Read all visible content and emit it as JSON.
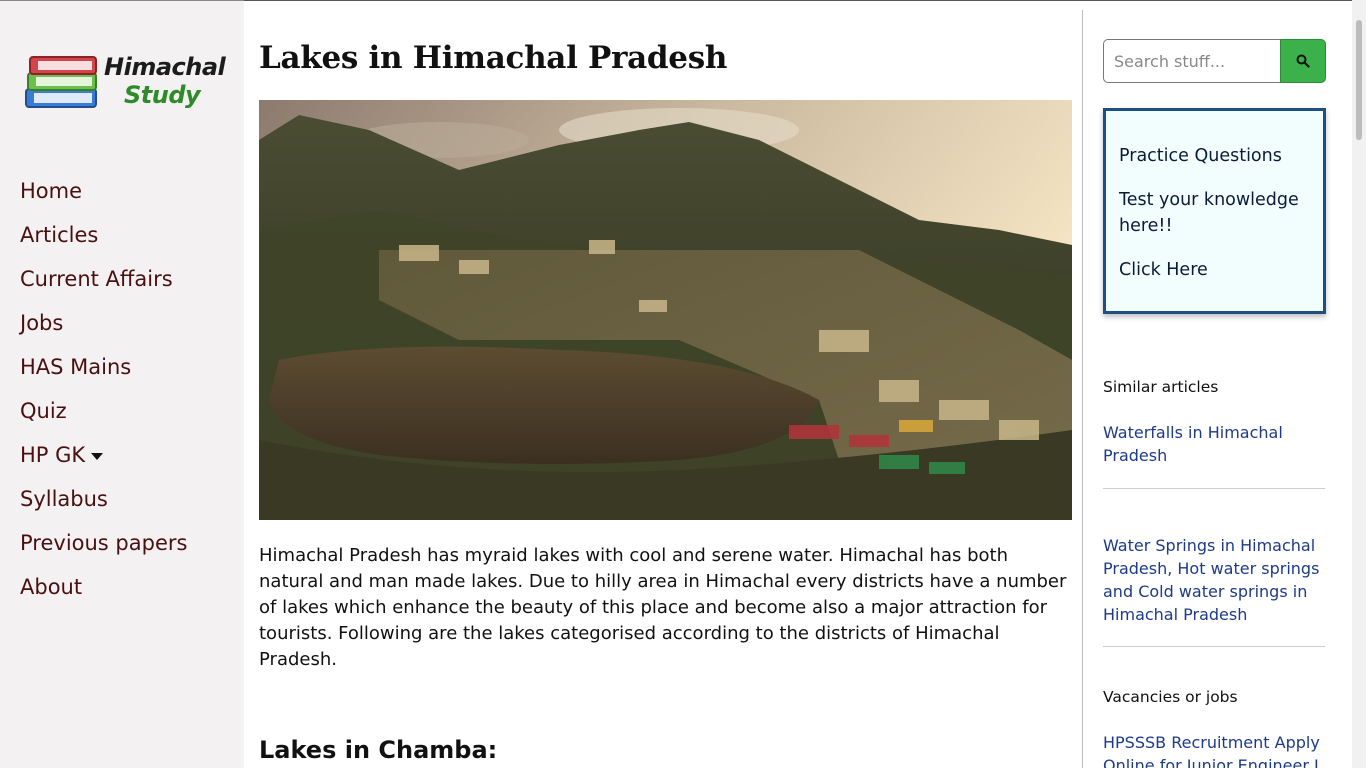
{
  "logo": {
    "line1": "Himachal",
    "line2": "Study"
  },
  "nav": {
    "items": [
      {
        "label": "Home"
      },
      {
        "label": "Articles"
      },
      {
        "label": "Current Affairs"
      },
      {
        "label": "Jobs"
      },
      {
        "label": "HAS Mains"
      },
      {
        "label": "Quiz"
      },
      {
        "label": "HP GK",
        "has_dropdown": true
      },
      {
        "label": "Syllabus"
      },
      {
        "label": "Previous papers"
      },
      {
        "label": "About"
      }
    ]
  },
  "article": {
    "title": "Lakes in Himachal Pradesh",
    "intro": "Himachal Pradesh has myraid lakes with cool and serene water. Himachal has both natural and man made lakes. Due to hilly area in Himachal every districts have a number of lakes which enhance the beauty of this place and become also a major attraction for tourists. Following are the lakes categorised according to the districts of Himachal Pradesh.",
    "section_heading": "Lakes in Chamba:"
  },
  "search": {
    "placeholder": "Search stuff...",
    "button_icon": "search-icon"
  },
  "practice": {
    "title": "Practice Questions",
    "text": "Test your knowledge here!!",
    "link": "Click Here"
  },
  "similar": {
    "heading": "Similar articles",
    "links": [
      "Waterfalls in Himachal Pradesh",
      "Water Springs in Himachal Pradesh, Hot water springs and Cold water springs in Himachal Pradesh"
    ]
  },
  "vacancies": {
    "heading": "Vacancies or jobs",
    "links": [
      "HPSSSB Recruitment Apply Online for Junior Engineer J"
    ]
  },
  "colors": {
    "sidebar_bg": "#f3f1f2",
    "nav_text": "#4a1010",
    "link": "#1d3a8a",
    "search_btn": "#3cb04a",
    "practice_border": "#1e4e82"
  }
}
